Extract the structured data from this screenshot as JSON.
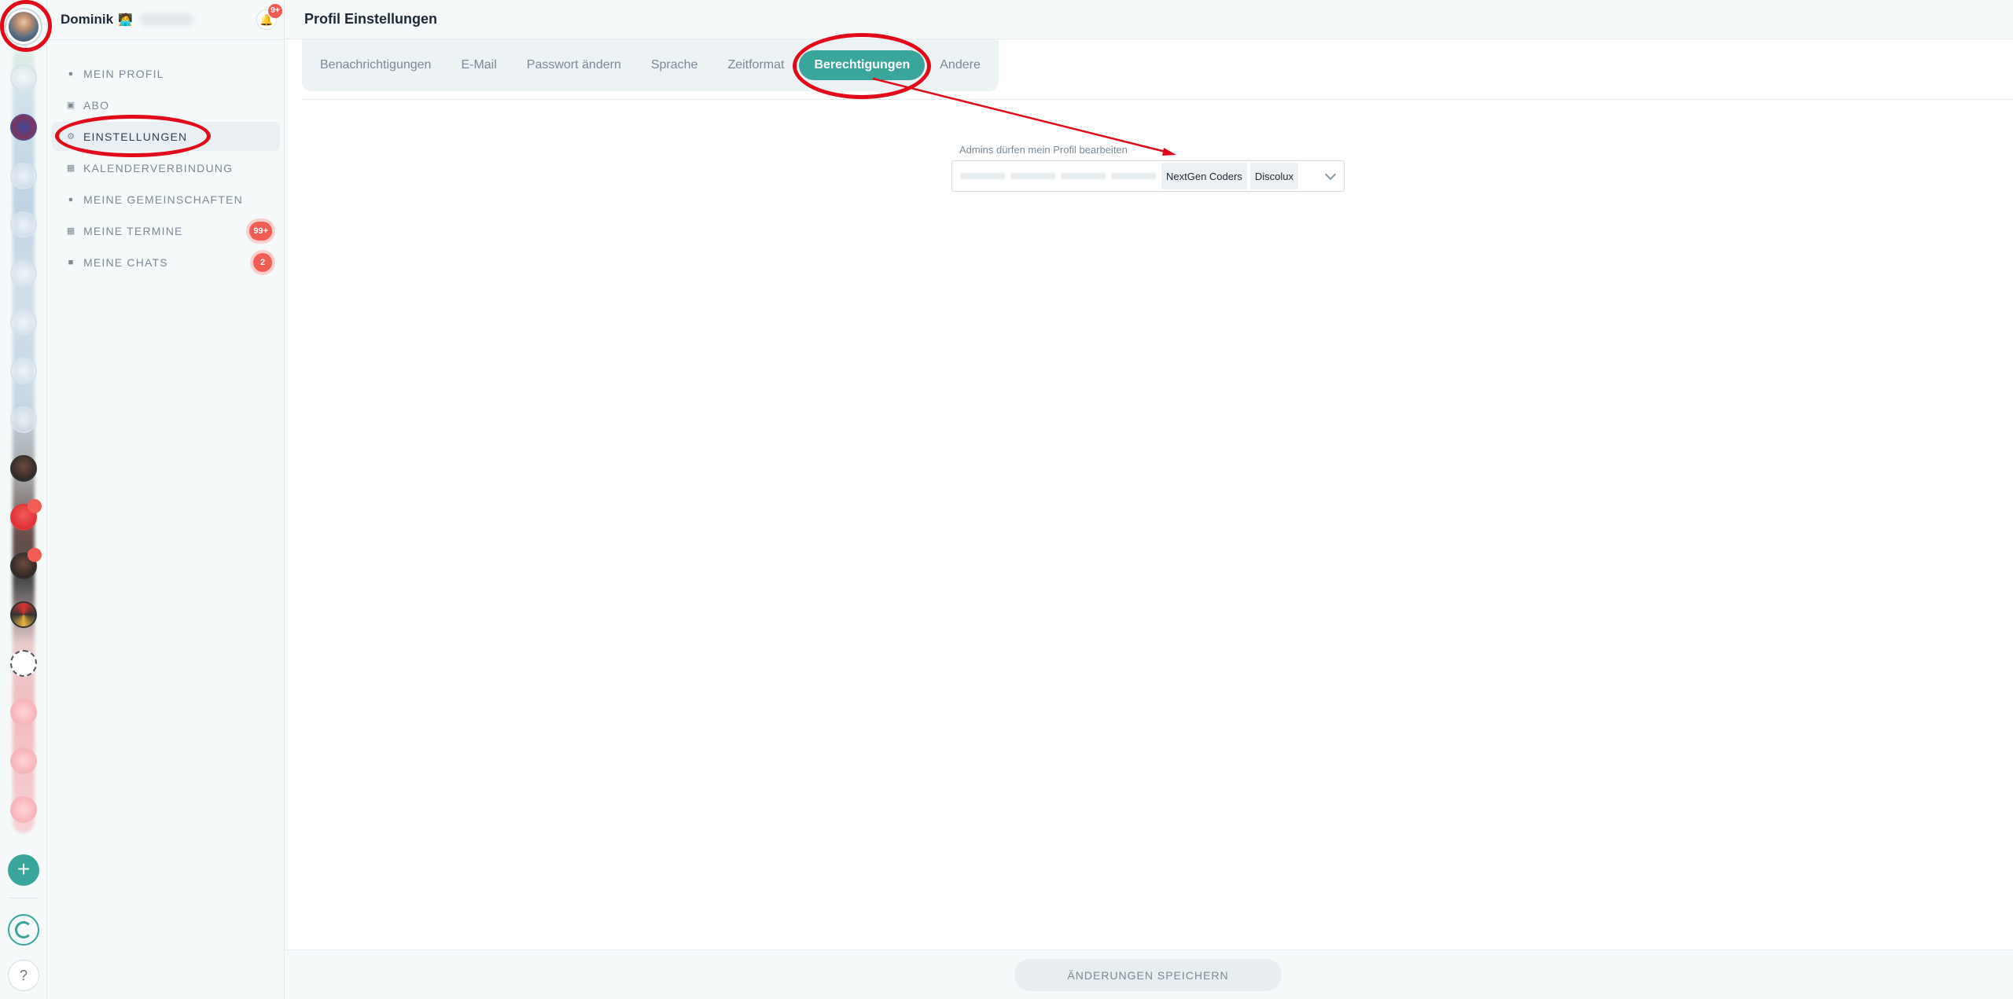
{
  "sidebar": {
    "user_name": "Dominik",
    "user_emoji": "🧑‍💻",
    "notification_badge": "9+",
    "items": [
      {
        "label": "MEIN PROFIL",
        "icon": "person-icon"
      },
      {
        "label": "ABO",
        "icon": "card-icon"
      },
      {
        "label": "EINSTELLUNGEN",
        "icon": "gear-icon",
        "active": true
      },
      {
        "label": "KALENDERVERBINDUNG",
        "icon": "calendar-sync-icon"
      },
      {
        "label": "MEINE GEMEINSCHAFTEN",
        "icon": "group-icon"
      },
      {
        "label": "MEINE TERMINE",
        "icon": "calendar-icon",
        "badge": "99+"
      },
      {
        "label": "MEINE CHATS",
        "icon": "chat-icon",
        "badge": "2"
      }
    ]
  },
  "main": {
    "title": "Profil Einstellungen",
    "tabs": [
      {
        "label": "Benachrichtigungen"
      },
      {
        "label": "E-Mail"
      },
      {
        "label": "Passwort ändern"
      },
      {
        "label": "Sprache"
      },
      {
        "label": "Zeitformat"
      },
      {
        "label": "Berechtigungen",
        "active": true
      },
      {
        "label": "Andere"
      }
    ],
    "permissions": {
      "label": "Admins dürfen mein Profil bearbeiten",
      "selected": [
        "NextGen Coders",
        "Discolux"
      ]
    },
    "save_label": "ÄNDERUNGEN SPEICHERN"
  },
  "colors": {
    "accent": "#3aa59b",
    "badge": "#f25c54",
    "annotation": "#e00a1a"
  }
}
